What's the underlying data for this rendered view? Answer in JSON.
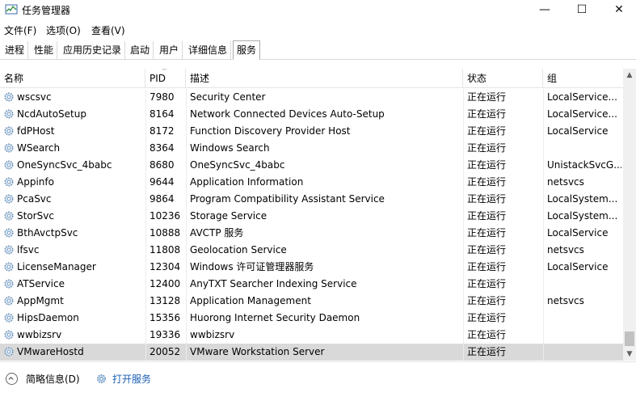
{
  "window": {
    "title": "任务管理器",
    "controls": {
      "minimize": "—",
      "maximize": "☐",
      "close": "✕"
    }
  },
  "menu": [
    "文件(F)",
    "选项(O)",
    "查看(V)"
  ],
  "tabs": [
    {
      "label": "进程",
      "active": false
    },
    {
      "label": "性能",
      "active": false
    },
    {
      "label": "应用历史记录",
      "active": false
    },
    {
      "label": "启动",
      "active": false
    },
    {
      "label": "用户",
      "active": false
    },
    {
      "label": "详细信息",
      "active": false
    },
    {
      "label": "服务",
      "active": true
    }
  ],
  "table": {
    "columns": [
      "名称",
      "PID",
      "描述",
      "状态",
      "组"
    ],
    "sorted_column": "PID",
    "rows": [
      {
        "name": "wscsvc",
        "pid": "7980",
        "desc": "Security Center",
        "status": "正在运行",
        "group": "LocalService..."
      },
      {
        "name": "NcdAutoSetup",
        "pid": "8164",
        "desc": "Network Connected Devices Auto-Setup",
        "status": "正在运行",
        "group": "LocalService..."
      },
      {
        "name": "fdPHost",
        "pid": "8172",
        "desc": "Function Discovery Provider Host",
        "status": "正在运行",
        "group": "LocalService"
      },
      {
        "name": "WSearch",
        "pid": "8364",
        "desc": "Windows Search",
        "status": "正在运行",
        "group": ""
      },
      {
        "name": "OneSyncSvc_4babc",
        "pid": "8680",
        "desc": "OneSyncSvc_4babc",
        "status": "正在运行",
        "group": "UnistackSvcG..."
      },
      {
        "name": "Appinfo",
        "pid": "9644",
        "desc": "Application Information",
        "status": "正在运行",
        "group": "netsvcs"
      },
      {
        "name": "PcaSvc",
        "pid": "9864",
        "desc": "Program Compatibility Assistant Service",
        "status": "正在运行",
        "group": "LocalSystem..."
      },
      {
        "name": "StorSvc",
        "pid": "10236",
        "desc": "Storage Service",
        "status": "正在运行",
        "group": "LocalSystem..."
      },
      {
        "name": "BthAvctpSvc",
        "pid": "10888",
        "desc": "AVCTP 服务",
        "status": "正在运行",
        "group": "LocalService"
      },
      {
        "name": "lfsvc",
        "pid": "11808",
        "desc": "Geolocation Service",
        "status": "正在运行",
        "group": "netsvcs"
      },
      {
        "name": "LicenseManager",
        "pid": "12304",
        "desc": "Windows 许可证管理器服务",
        "status": "正在运行",
        "group": "LocalService"
      },
      {
        "name": "ATService",
        "pid": "12400",
        "desc": "AnyTXT Searcher Indexing Service",
        "status": "正在运行",
        "group": ""
      },
      {
        "name": "AppMgmt",
        "pid": "13128",
        "desc": "Application Management",
        "status": "正在运行",
        "group": "netsvcs"
      },
      {
        "name": "HipsDaemon",
        "pid": "15356",
        "desc": "Huorong Internet Security Daemon",
        "status": "正在运行",
        "group": ""
      },
      {
        "name": "wwbizsrv",
        "pid": "19336",
        "desc": "wwbizsrv",
        "status": "正在运行",
        "group": ""
      },
      {
        "name": "VMwareHostd",
        "pid": "20052",
        "desc": "VMware Workstation Server",
        "status": "正在运行",
        "group": "",
        "selected": true
      }
    ]
  },
  "footer": {
    "less_details": "简略信息(D)",
    "open_services": "打开服务"
  },
  "colors": {
    "selected_row": "#d9d9d9",
    "gear_blue": "#5b8bb8",
    "link_blue": "#1a5fb4"
  }
}
